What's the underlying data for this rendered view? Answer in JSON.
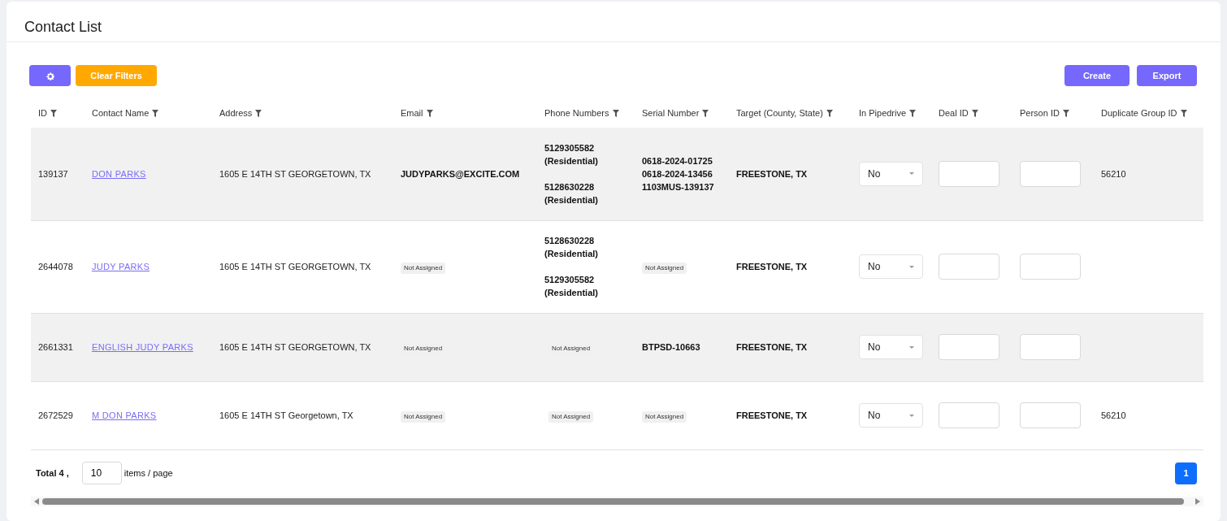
{
  "title": "Contact List",
  "toolbar": {
    "clear_filters": "Clear Filters",
    "create": "Create",
    "export": "Export"
  },
  "columns": [
    "ID",
    "Contact Name",
    "Address",
    "Email",
    "Phone Numbers",
    "Serial Number",
    "Target (County, State)",
    "In Pipedrive",
    "Deal ID",
    "Person ID",
    "Duplicate Group ID"
  ],
  "rows": [
    {
      "id": "139137",
      "name": "DON PARKS",
      "address": "1605 E 14TH ST GEORGETOWN, TX",
      "email": {
        "kind": "text",
        "text": "JUDYPARKS@EXCITE.COM"
      },
      "phones": {
        "kind": "list",
        "items": [
          {
            "number": "5129305582",
            "type": "(Residential)"
          },
          {
            "number": "5128630228",
            "type": "(Residential)"
          }
        ]
      },
      "serials": {
        "kind": "list",
        "items": [
          "0618-2024-01725",
          "0618-2024-13456",
          "1103MUS-139137"
        ]
      },
      "target": "FREESTONE, TX",
      "in_pipedrive": "No",
      "duplicate_group": "56210"
    },
    {
      "id": "2644078",
      "name": "JUDY PARKS",
      "address": "1605 E 14TH ST GEORGETOWN, TX",
      "email": {
        "kind": "tag",
        "text": "Not Assigned"
      },
      "phones": {
        "kind": "list",
        "items": [
          {
            "number": "5128630228",
            "type": "(Residential)"
          },
          {
            "number": "5129305582",
            "type": "(Residential)"
          }
        ]
      },
      "serials": {
        "kind": "tag",
        "text": "Not Assigned"
      },
      "target": "FREESTONE, TX",
      "in_pipedrive": "No"
    },
    {
      "id": "2661331",
      "name": "ENGLISH JUDY PARKS",
      "address": "1605 E 14TH ST GEORGETOWN, TX",
      "email": {
        "kind": "tag",
        "text": "Not Assigned"
      },
      "phones": {
        "kind": "tag",
        "text": "Not Assigned"
      },
      "serials": {
        "kind": "list",
        "items": [
          "BTPSD-10663"
        ]
      },
      "target": "FREESTONE, TX",
      "in_pipedrive": "No"
    },
    {
      "id": "2672529",
      "name": "M DON PARKS",
      "address": "1605 E 14TH ST Georgetown, TX",
      "email": {
        "kind": "tag",
        "text": "Not Assigned"
      },
      "phones": {
        "kind": "tag",
        "text": "Not Assigned"
      },
      "serials": {
        "kind": "tag",
        "text": "Not Assigned"
      },
      "target": "FREESTONE, TX",
      "in_pipedrive": "No",
      "duplicate_group": "56210"
    }
  ],
  "footer": {
    "total": "Total 4 ,",
    "page_size": "10",
    "page_size_label": "items / page",
    "pages": [
      {
        "label": "1",
        "selected": true
      }
    ]
  }
}
